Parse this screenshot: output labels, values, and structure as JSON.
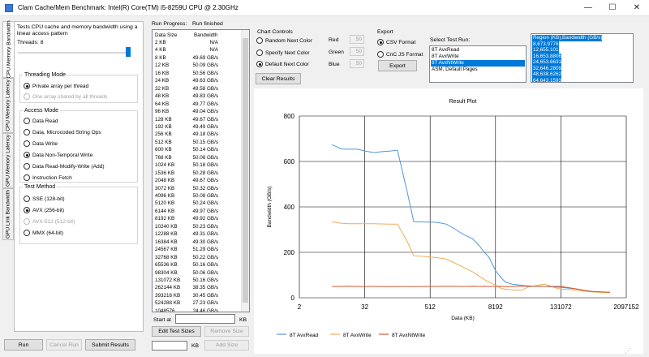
{
  "window": {
    "title": "Clam Cache/Mem Benchmark: Intel(R) Core(TM) i5-8259U CPU @ 2.30GHz",
    "minimize_glyph": "—",
    "maximize_glyph": "☐",
    "close_glyph": "✕"
  },
  "tabs": [
    {
      "label": "CPU Memory Bandwidth",
      "active": true
    },
    {
      "label": "CPU Memory Latency",
      "active": false
    },
    {
      "label": "GPU Memory Latency",
      "active": false
    },
    {
      "label": "GPU Link Bandwidth",
      "active": false
    }
  ],
  "left": {
    "description": "Tests CPU cache and memory bandwidth using a linear access pattern",
    "threads_label": "Threads: 8",
    "threading_mode": {
      "legend": "Threading Mode",
      "options": [
        {
          "label": "Private array per thread",
          "checked": true,
          "enabled": true
        },
        {
          "label": "One array shared by all threads",
          "checked": false,
          "enabled": false
        }
      ]
    },
    "access_mode": {
      "legend": "Access Mode",
      "options": [
        {
          "label": "Data Read",
          "checked": false,
          "enabled": true
        },
        {
          "label": "Data, Microcoded String Ops",
          "checked": false,
          "enabled": true
        },
        {
          "label": "Data Write",
          "checked": false,
          "enabled": true
        },
        {
          "label": "Data Non-Temporal Write",
          "checked": true,
          "enabled": true
        },
        {
          "label": "Data Read-Modify-Write (Add)",
          "checked": false,
          "enabled": true
        },
        {
          "label": "Instruction Fetch",
          "checked": false,
          "enabled": true
        }
      ]
    },
    "test_method": {
      "legend": "Test Method",
      "options": [
        {
          "label": "SSE (128-bit)",
          "checked": false,
          "enabled": true
        },
        {
          "label": "AVX (256-bit)",
          "checked": true,
          "enabled": true
        },
        {
          "label": "AVX-512 (512-bit)",
          "checked": false,
          "enabled": false
        },
        {
          "label": "MMX (64-bit)",
          "checked": false,
          "enabled": true
        }
      ]
    },
    "run_button": "Run",
    "cancel_button": "Cancel Run",
    "submit_button": "Submit Results"
  },
  "run_progress": {
    "label": "Run Progress:",
    "status": "Run finished",
    "col_size": "Data Size",
    "col_bw": "Bandwidth",
    "rows": [
      [
        "2 KB",
        "N/A"
      ],
      [
        "4 KB",
        "N/A"
      ],
      [
        "8 KB",
        "49.69 GB/s"
      ],
      [
        "12 KB",
        "50.09 GB/s"
      ],
      [
        "16 KB",
        "50.56 GB/s"
      ],
      [
        "24 KB",
        "49.63 GB/s"
      ],
      [
        "32 KB",
        "49.58 GB/s"
      ],
      [
        "48 KB",
        "49.83 GB/s"
      ],
      [
        "64 KB",
        "49.77 GB/s"
      ],
      [
        "96 KB",
        "49.04 GB/s"
      ],
      [
        "128 KB",
        "49.67 GB/s"
      ],
      [
        "192 KB",
        "49.49 GB/s"
      ],
      [
        "256 KB",
        "49.18 GB/s"
      ],
      [
        "512 KB",
        "50.15 GB/s"
      ],
      [
        "600 KB",
        "50.14 GB/s"
      ],
      [
        "768 KB",
        "50.06 GB/s"
      ],
      [
        "1024 KB",
        "50.18 GB/s"
      ],
      [
        "1536 KB",
        "50.28 GB/s"
      ],
      [
        "2048 KB",
        "49.67 GB/s"
      ],
      [
        "3072 KB",
        "50.32 GB/s"
      ],
      [
        "4096 KB",
        "50.08 GB/s"
      ],
      [
        "5120 KB",
        "50.24 GB/s"
      ],
      [
        "6144 KB",
        "49.97 GB/s"
      ],
      [
        "8192 KB",
        "49.92 GB/s"
      ],
      [
        "10240 KB",
        "50.23 GB/s"
      ],
      [
        "12288 KB",
        "49.31 GB/s"
      ],
      [
        "16384 KB",
        "49.30 GB/s"
      ],
      [
        "24567 KB",
        "51.29 GB/s"
      ],
      [
        "32768 KB",
        "50.22 GB/s"
      ],
      [
        "65536 KB",
        "50.16 GB/s"
      ],
      [
        "98304 KB",
        "50.06 GB/s"
      ],
      [
        "131072 KB",
        "50.16 GB/s"
      ],
      [
        "262144 KB",
        "38.35 GB/s"
      ],
      [
        "393216 KB",
        "30.45 GB/s"
      ],
      [
        "524288 KB",
        "27.23 GB/s"
      ],
      [
        "1048576",
        "24.46 GB/s"
      ]
    ],
    "start_at_label": "Start at",
    "start_unit": "KB",
    "edit_sizes_button": "Edit Test Sizes",
    "remove_size_button": "Remove Size",
    "add_unit": "KB",
    "add_size_button": "Add Size"
  },
  "chart_controls": {
    "legend": "Chart Controls",
    "options": [
      {
        "label": "Random Next Color",
        "checked": false
      },
      {
        "label": "Specify Next Color",
        "checked": false
      },
      {
        "label": "Default Next Color",
        "checked": true
      }
    ],
    "red_label": "Red",
    "red_value": "50",
    "green_label": "Green",
    "green_value": "50",
    "blue_label": "Blue",
    "blue_value": "50",
    "clear_button": "Clear Results"
  },
  "export": {
    "legend": "Export",
    "csv_label": "CSV Format",
    "cnc_label": "CnC JS Format",
    "export_button": "Export",
    "select_label": "Select Test Run:",
    "runs": [
      {
        "label": "8T AvxRead",
        "selected": false
      },
      {
        "label": "8T AvxWrite",
        "selected": false
      },
      {
        "label": "8T AvxNtWrite",
        "selected": true
      },
      {
        "label": "ASM, Default Pages",
        "selected": false
      }
    ],
    "output_lines": [
      "Region (KB),Bandwidth (GB/s)",
      "8,673.9776",
      "12,655.101",
      "16,653.8806",
      "24,653.6631",
      "32,646.2809",
      "48,638.6262",
      "64,643.1593"
    ]
  },
  "chart_data": {
    "type": "line",
    "title": "Result Plot",
    "xlabel": "Data (KB)",
    "ylabel": "Bandwidth (GB/s)",
    "x_scale": "log2",
    "xlim": [
      2,
      2097152
    ],
    "ylim": [
      0,
      800
    ],
    "x_ticks": [
      "2",
      "32",
      "512",
      "8192",
      "131072",
      "2097152"
    ],
    "y_ticks": [
      "0",
      "200",
      "400",
      "600",
      "800"
    ],
    "grid": true,
    "legend_position": "bottom",
    "series": [
      {
        "name": "8T AvxRead",
        "color": "#4f97df",
        "x": [
          8,
          12,
          16,
          24,
          32,
          48,
          64,
          96,
          128,
          192,
          256,
          512,
          600,
          768,
          1024,
          1536,
          2048,
          3072,
          4096,
          5120,
          6144,
          8192,
          10240,
          12288,
          16384,
          24567,
          32768,
          65536,
          98304,
          131072,
          262144,
          393216,
          524288,
          1048576
        ],
        "y": [
          674,
          655,
          654,
          654,
          646,
          639,
          643,
          646,
          650,
          470,
          335,
          333,
          333,
          330,
          324,
          300,
          280,
          260,
          230,
          200,
          180,
          120,
          90,
          70,
          60,
          55,
          52,
          50,
          48,
          46,
          38,
          31,
          27,
          24
        ]
      },
      {
        "name": "8T AvxWrite",
        "color": "#f0ac56",
        "x": [
          8,
          12,
          16,
          24,
          32,
          48,
          64,
          96,
          128,
          192,
          256,
          512,
          600,
          768,
          1024,
          1536,
          2048,
          3072,
          4096,
          5120,
          6144,
          8192,
          10240,
          12288,
          16384,
          24567,
          32768,
          65536,
          98304,
          131072,
          262144,
          393216,
          524288,
          1048576
        ],
        "y": [
          335,
          328,
          326,
          326,
          326,
          326,
          325,
          324,
          324,
          250,
          185,
          180,
          178,
          175,
          170,
          150,
          135,
          115,
          95,
          80,
          70,
          55,
          42,
          38,
          35,
          33,
          48,
          60,
          45,
          38,
          33,
          28,
          25,
          22
        ]
      },
      {
        "name": "8T AvxNtWrite",
        "color": "#d7582e",
        "x": [
          8,
          12,
          16,
          24,
          32,
          48,
          64,
          96,
          128,
          192,
          256,
          512,
          600,
          768,
          1024,
          1536,
          2048,
          3072,
          4096,
          5120,
          6144,
          8192,
          10240,
          12288,
          16384,
          24567,
          32768,
          65536,
          98304,
          131072,
          262144,
          393216,
          524288,
          1048576
        ],
        "y": [
          49.69,
          50.09,
          50.56,
          49.63,
          49.58,
          49.83,
          49.77,
          49.04,
          49.67,
          49.49,
          49.18,
          50.15,
          50.14,
          50.06,
          50.18,
          50.28,
          49.67,
          50.32,
          50.08,
          50.24,
          49.97,
          49.92,
          50.23,
          49.31,
          49.3,
          51.29,
          50.22,
          50.16,
          50.06,
          50.16,
          38.35,
          30.45,
          27.23,
          24.46
        ]
      }
    ]
  }
}
